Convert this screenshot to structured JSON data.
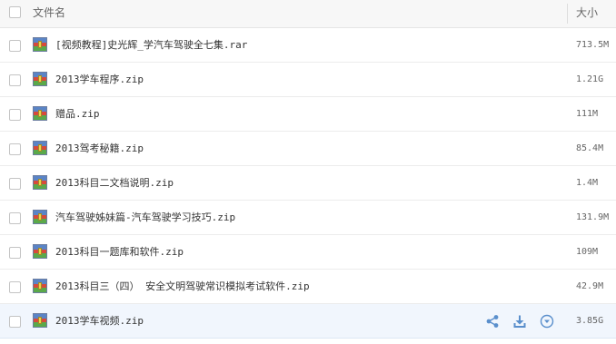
{
  "header": {
    "name_label": "文件名",
    "size_label": "大小"
  },
  "files": [
    {
      "name": "[视频教程]史光辉_学汽车驾驶全七集.rar",
      "size": "713.5M",
      "icon": "zip-archive-icon"
    },
    {
      "name": "2013学车程序.zip",
      "size": "1.21G",
      "icon": "zip-archive-icon"
    },
    {
      "name": "赠品.zip",
      "size": "111M",
      "icon": "zip-archive-icon"
    },
    {
      "name": "2013驾考秘籍.zip",
      "size": "85.4M",
      "icon": "zip-archive-icon"
    },
    {
      "name": "2013科目二文档说明.zip",
      "size": "1.4M",
      "icon": "zip-archive-icon"
    },
    {
      "name": "汽车驾驶姊妹篇-汽车驾驶学习技巧.zip",
      "size": "131.9M",
      "icon": "zip-archive-icon"
    },
    {
      "name": "2013科目一题库和软件.zip",
      "size": "109M",
      "icon": "zip-archive-icon"
    },
    {
      "name": "2013科目三（四） 安全文明驾驶常识模拟考试软件.zip",
      "size": "42.9M",
      "icon": "zip-archive-icon"
    },
    {
      "name": "2013学车视频.zip",
      "size": "3.85G",
      "icon": "zip-archive-icon"
    }
  ],
  "hover_row_actions": [
    "share-icon",
    "download-icon",
    "more-dropdown-icon"
  ],
  "colors": {
    "action_blue": "#5a8fcc",
    "hover_row_bg": "#f1f6fd"
  }
}
